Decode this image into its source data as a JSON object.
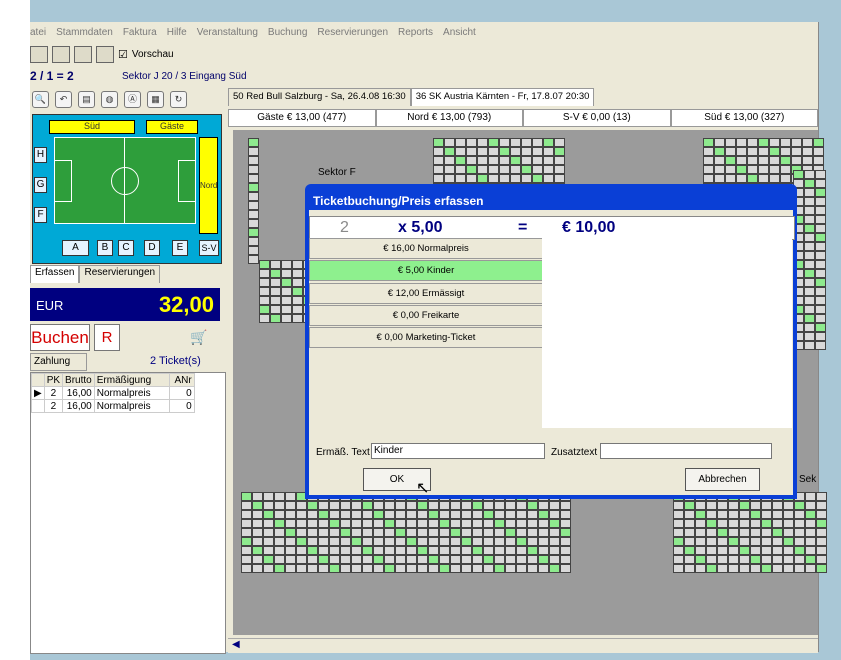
{
  "menu": [
    "atei",
    "Stammdaten",
    "Faktura",
    "Hilfe",
    "Veranstaltung",
    "Buchung",
    "Reservierungen",
    "Reports",
    "Ansicht"
  ],
  "toolbar": {
    "vorschau_label": "Vorschau",
    "vorschau_checked": true
  },
  "infobar": {
    "count": "2 / 1 = 2",
    "location": "Sektor J 20 / 3  Eingang Süd"
  },
  "minimap": {
    "sued": "Süd",
    "gaeste": "Gäste",
    "nord": "Nord",
    "sektor_h": "H",
    "sektor_g": "G",
    "sektor_f": "F",
    "bottom_sectors": [
      "A",
      "B",
      "C",
      "D",
      "E",
      "S-V"
    ]
  },
  "left_tabs": [
    "Erfassen",
    "Reservierungen"
  ],
  "summary": {
    "currency": "EUR",
    "amount": "32,00"
  },
  "buttons": {
    "buchen": "Buchen",
    "r": "R"
  },
  "zahlung_label": "Zahlung",
  "tickets_count": "2 Ticket(s)",
  "ticket_table": {
    "headers": [
      "PK",
      "Brutto",
      "Ermäßigung",
      "ANr"
    ],
    "rows": [
      [
        "2",
        "16,00",
        "Normalpreis",
        "0"
      ],
      [
        "2",
        "16,00",
        "Normalpreis",
        "0"
      ]
    ]
  },
  "event_tabs": [
    "50 Red Bull Salzburg - Sa, 26.4.08  16:30",
    "36 SK Austria Kärnten - Fr, 17.8.07  20:30"
  ],
  "price_tabs": [
    "Gäste € 13,00 (477)",
    "Nord € 13,00 (793)",
    "S-V € 0,00 (13)",
    "Süd € 13,00 (327)"
  ],
  "seat_labels": {
    "sektor_f": "Sektor F",
    "sek": "Sek"
  },
  "dialog": {
    "title": "Ticketbuchung/Preis erfassen",
    "quantity": "2",
    "times": "x 5,00",
    "equals": "=",
    "total": "€ 10,00",
    "prices": [
      {
        "label": "€ 16,00  Normalpreis",
        "selected": false
      },
      {
        "label": "€ 5,00  Kinder",
        "selected": true
      },
      {
        "label": "€ 12,00  Ermässigt",
        "selected": false
      },
      {
        "label": "€ 0,00  Freikarte",
        "selected": false
      },
      {
        "label": "€ 0,00  Marketing-Ticket",
        "selected": false
      }
    ],
    "erm_label": "Ermäß. Text",
    "erm_value": "Kinder",
    "zusatz_label": "Zusatztext",
    "zusatz_value": "",
    "ok": "OK",
    "abbrechen": "Abbrechen"
  },
  "colors": {
    "dialog_title_bg": "#0a3fd6",
    "selected_price": "#8ef08e",
    "seat_free": "#8eea8e",
    "amount_bg": "#000080",
    "amount_fg": "#ffff00",
    "buchen_fg": "#d40000"
  }
}
